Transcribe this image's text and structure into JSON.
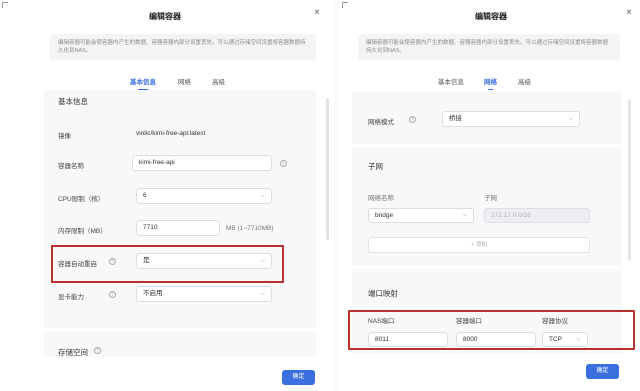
{
  "left": {
    "title": "编辑容器",
    "close": "×",
    "notice": "编辑容器可能会使容器内产生的数据、容器容器内部分设置丢失。可以通过存储空间设置将容器数据持久化到NAS。",
    "tabs": [
      "基本信息",
      "网络",
      "高级"
    ],
    "active_tab": "基本信息",
    "section_title": "基本信息",
    "rows": {
      "image_label": "镜像",
      "image_value": "vinlic/kimi-free-api:latest",
      "name_label": "容器名称",
      "name_value": "kimi-free-api",
      "cpu_label": "CPU限制（核）",
      "cpu_value": "6",
      "mem_label": "内存限制（MB）",
      "mem_value": "7710",
      "mem_hint": "MB (1~7710MB)",
      "autostart_label": "容器自动重启",
      "autostart_value": "是",
      "gpu_label": "显卡能力",
      "gpu_value": "不启用"
    },
    "storage_title": "存储空间",
    "confirm": "确定"
  },
  "right": {
    "title": "编辑容器",
    "close": "×",
    "notice": "编辑容器可能会使容器内产生的数据、容器容器内部分设置丢失。可以通过存储空间设置将容器数据持久化到NAS。",
    "tabs": [
      "基本信息",
      "网络",
      "高级"
    ],
    "active_tab": "网络",
    "network_mode_label": "网络模式",
    "network_mode_value": "桥接",
    "subnet_title": "子网",
    "net_name_label": "网络名称",
    "net_name_value": "bridge",
    "subnet_label": "子网",
    "subnet_value": "172.17.0.0/16",
    "add_label": "+ 添加",
    "port_title": "端口映射",
    "port_headers": [
      "NAS端口",
      "容器端口",
      "容器协议"
    ],
    "port_nas": "8011",
    "port_container": "8000",
    "port_protocol": "TCP",
    "confirm": "确定"
  },
  "colors": {
    "accent": "#3b6fe0",
    "highlight_border": "#b4322b"
  }
}
